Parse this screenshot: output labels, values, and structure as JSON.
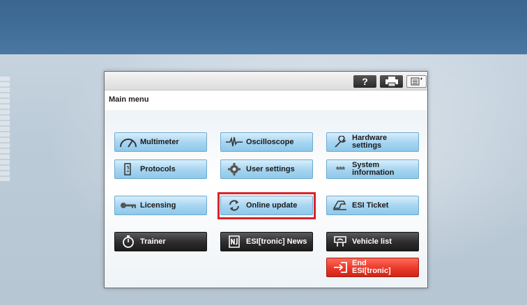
{
  "colors": {
    "top_band": "#3e6b95",
    "blue_button": "#a8d6f2",
    "dark_button": "#2c2c2c",
    "red_button": "#e8392a",
    "highlight": "#d9242b"
  },
  "toolbar": {
    "help_label": "?",
    "icons": [
      "help-icon",
      "printer-icon",
      "list-icon"
    ]
  },
  "main_menu": {
    "title": "Main menu",
    "buttons": [
      {
        "label": "Multimeter",
        "icon": "gauge-icon",
        "style": "blue"
      },
      {
        "label": "Oscilloscope",
        "icon": "waveform-icon",
        "style": "blue"
      },
      {
        "label": "Hardware settings",
        "icon": "wrench-icon",
        "style": "blue"
      },
      {
        "label": "Protocols",
        "icon": "document-icon",
        "style": "blue"
      },
      {
        "label": "User settings",
        "icon": "gear-icon",
        "style": "blue"
      },
      {
        "label": "System information",
        "icon": "asterisks-icon",
        "style": "blue"
      },
      {
        "label": "Licensing",
        "icon": "key-icon",
        "style": "blue"
      },
      {
        "label": "Online update",
        "icon": "refresh-icon",
        "style": "blue",
        "highlighted": true
      },
      {
        "label": "ESI Ticket",
        "icon": "ticket-icon",
        "style": "blue"
      },
      {
        "label": "Trainer",
        "icon": "stopwatch-icon",
        "style": "dark"
      },
      {
        "label": "ESI[tronic] News",
        "icon": "news-icon",
        "style": "dark"
      },
      {
        "label": "Vehicle list",
        "icon": "vehicle-list-icon",
        "style": "dark"
      },
      {
        "label": "End ESI[tronic]",
        "icon": "exit-icon",
        "style": "red"
      }
    ]
  }
}
